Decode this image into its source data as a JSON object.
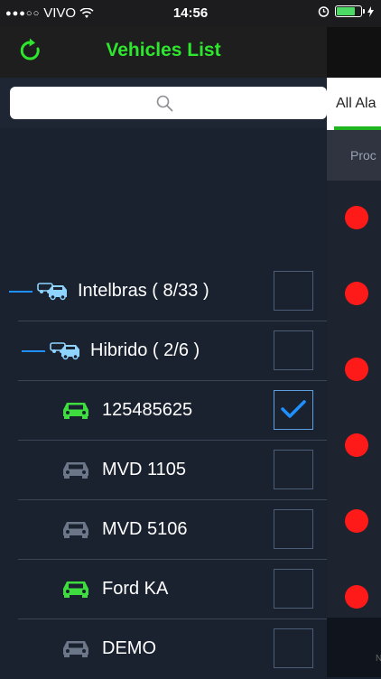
{
  "status_bar": {
    "carrier": "VIVO",
    "time": "14:56"
  },
  "header": {
    "title": "Vehicles List"
  },
  "search": {
    "placeholder": ""
  },
  "alarms_panel": {
    "tab_label": "All Ala",
    "column_header": "Proc",
    "bottom_text": "N"
  },
  "colors": {
    "accent_green": "#2ee62e",
    "alarm_red": "#ff1a1a",
    "check_blue": "#1e90ff"
  },
  "tree": [
    {
      "label": "Intelbras ( 8/33 )",
      "type": "group",
      "icon": "vehicles-group-icon",
      "checked": false
    },
    {
      "label": "Hibrido ( 2/6 )",
      "type": "group",
      "icon": "vehicles-group-icon",
      "checked": false
    },
    {
      "label": "125485625",
      "type": "vehicle",
      "icon": "car-icon",
      "status": "online",
      "checked": true
    },
    {
      "label": "MVD 1105",
      "type": "vehicle",
      "icon": "car-icon",
      "status": "offline",
      "checked": false
    },
    {
      "label": "MVD 5106",
      "type": "vehicle",
      "icon": "car-icon",
      "status": "offline",
      "checked": false
    },
    {
      "label": "Ford KA",
      "type": "vehicle",
      "icon": "car-icon",
      "status": "online",
      "checked": false
    },
    {
      "label": "DEMO",
      "type": "vehicle",
      "icon": "car-icon",
      "status": "offline",
      "checked": false
    }
  ]
}
